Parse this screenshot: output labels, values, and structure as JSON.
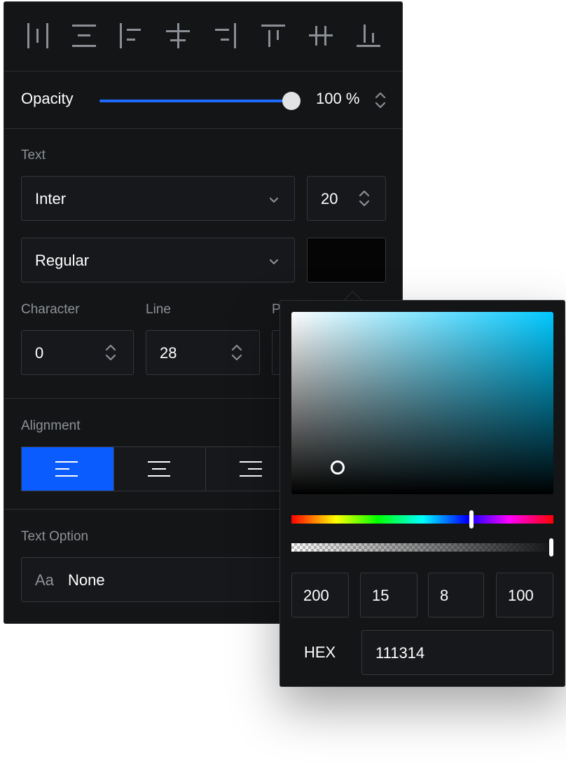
{
  "toolbar": {
    "tools": [
      "align-left-distribute-icon",
      "align-center-horizontal-icon",
      "align-left-icon",
      "align-center-vertical-icon",
      "align-right-icon",
      "align-top-icon",
      "align-middle-icon",
      "align-bottom-icon"
    ]
  },
  "opacity": {
    "label": "Opacity",
    "value_text": "100 %",
    "value": 100
  },
  "text_section": {
    "title": "Text",
    "font_family": "Inter",
    "font_size": "20",
    "font_weight": "Regular",
    "color_swatch": "#000000"
  },
  "spacing": {
    "character_label": "Character",
    "character_value": "0",
    "line_label": "Line",
    "line_value": "28",
    "paragraph_label_partial": "P"
  },
  "alignment": {
    "title": "Alignment",
    "active_index": 0
  },
  "text_option": {
    "title": "Text Option",
    "prefix": "Aa",
    "value": "None"
  },
  "color_picker": {
    "hue_value": 200,
    "saturation_value": 15,
    "brightness_value": 8,
    "alpha_value": 100,
    "hue": "200",
    "saturation": "15",
    "brightness": "8",
    "alpha": "100",
    "hex_label": "HEX",
    "hex_value": "111314"
  },
  "colors": {
    "panel_bg": "#141517",
    "accent": "#0a5cff",
    "slider": "#1e6bff"
  }
}
